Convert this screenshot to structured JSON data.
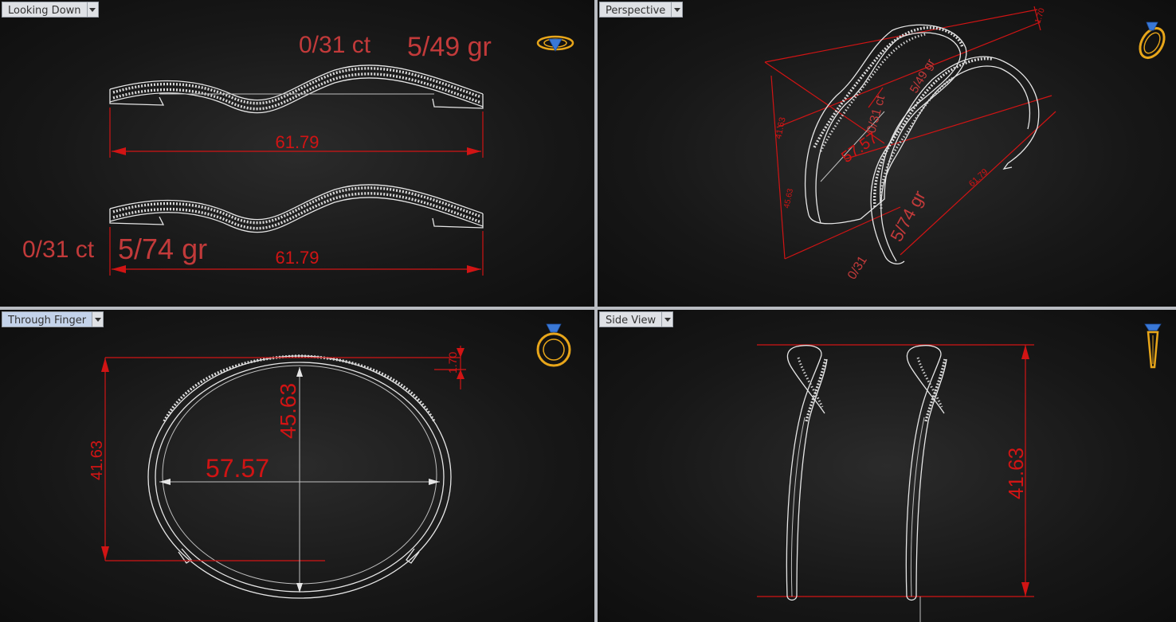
{
  "viewports": {
    "top_left": {
      "title": "Looking Down"
    },
    "top_right": {
      "title": "Perspective"
    },
    "bottom_left": {
      "title": "Through Finger"
    },
    "bottom_right": {
      "title": "Side View"
    }
  },
  "looking_down": {
    "upper_ct": "0/31 ct",
    "upper_gr": "5/49 gr",
    "upper_length": "61.79",
    "lower_ct": "0/31 ct",
    "lower_gr": "5/74 gr",
    "lower_length": "61.79"
  },
  "perspective": {
    "dim_height": "41.63",
    "dim_width": "57.57",
    "dim_length": "61.79",
    "dim_gap": "1.70",
    "dim_side": "45.63",
    "ct": "0/31 ct",
    "gr_top": "5/49 gr",
    "gr_bottom": "5/74 gr",
    "ct_bottom": "0/31"
  },
  "through_finger": {
    "height": "41.63",
    "inner_height": "45.63",
    "width": "57.57",
    "thickness": "1.70"
  },
  "side_view": {
    "height": "41.63"
  },
  "colors": {
    "dimension": "#d11414",
    "annotation": "#c23a3a",
    "wireframe": "#e6e6e6",
    "icon_gold": "#e8a61a",
    "icon_gem": "#3a78d6"
  },
  "icons": [
    "view-ring-top-icon",
    "view-ring-perspective-icon",
    "view-ring-front-icon",
    "view-ring-side-icon"
  ]
}
